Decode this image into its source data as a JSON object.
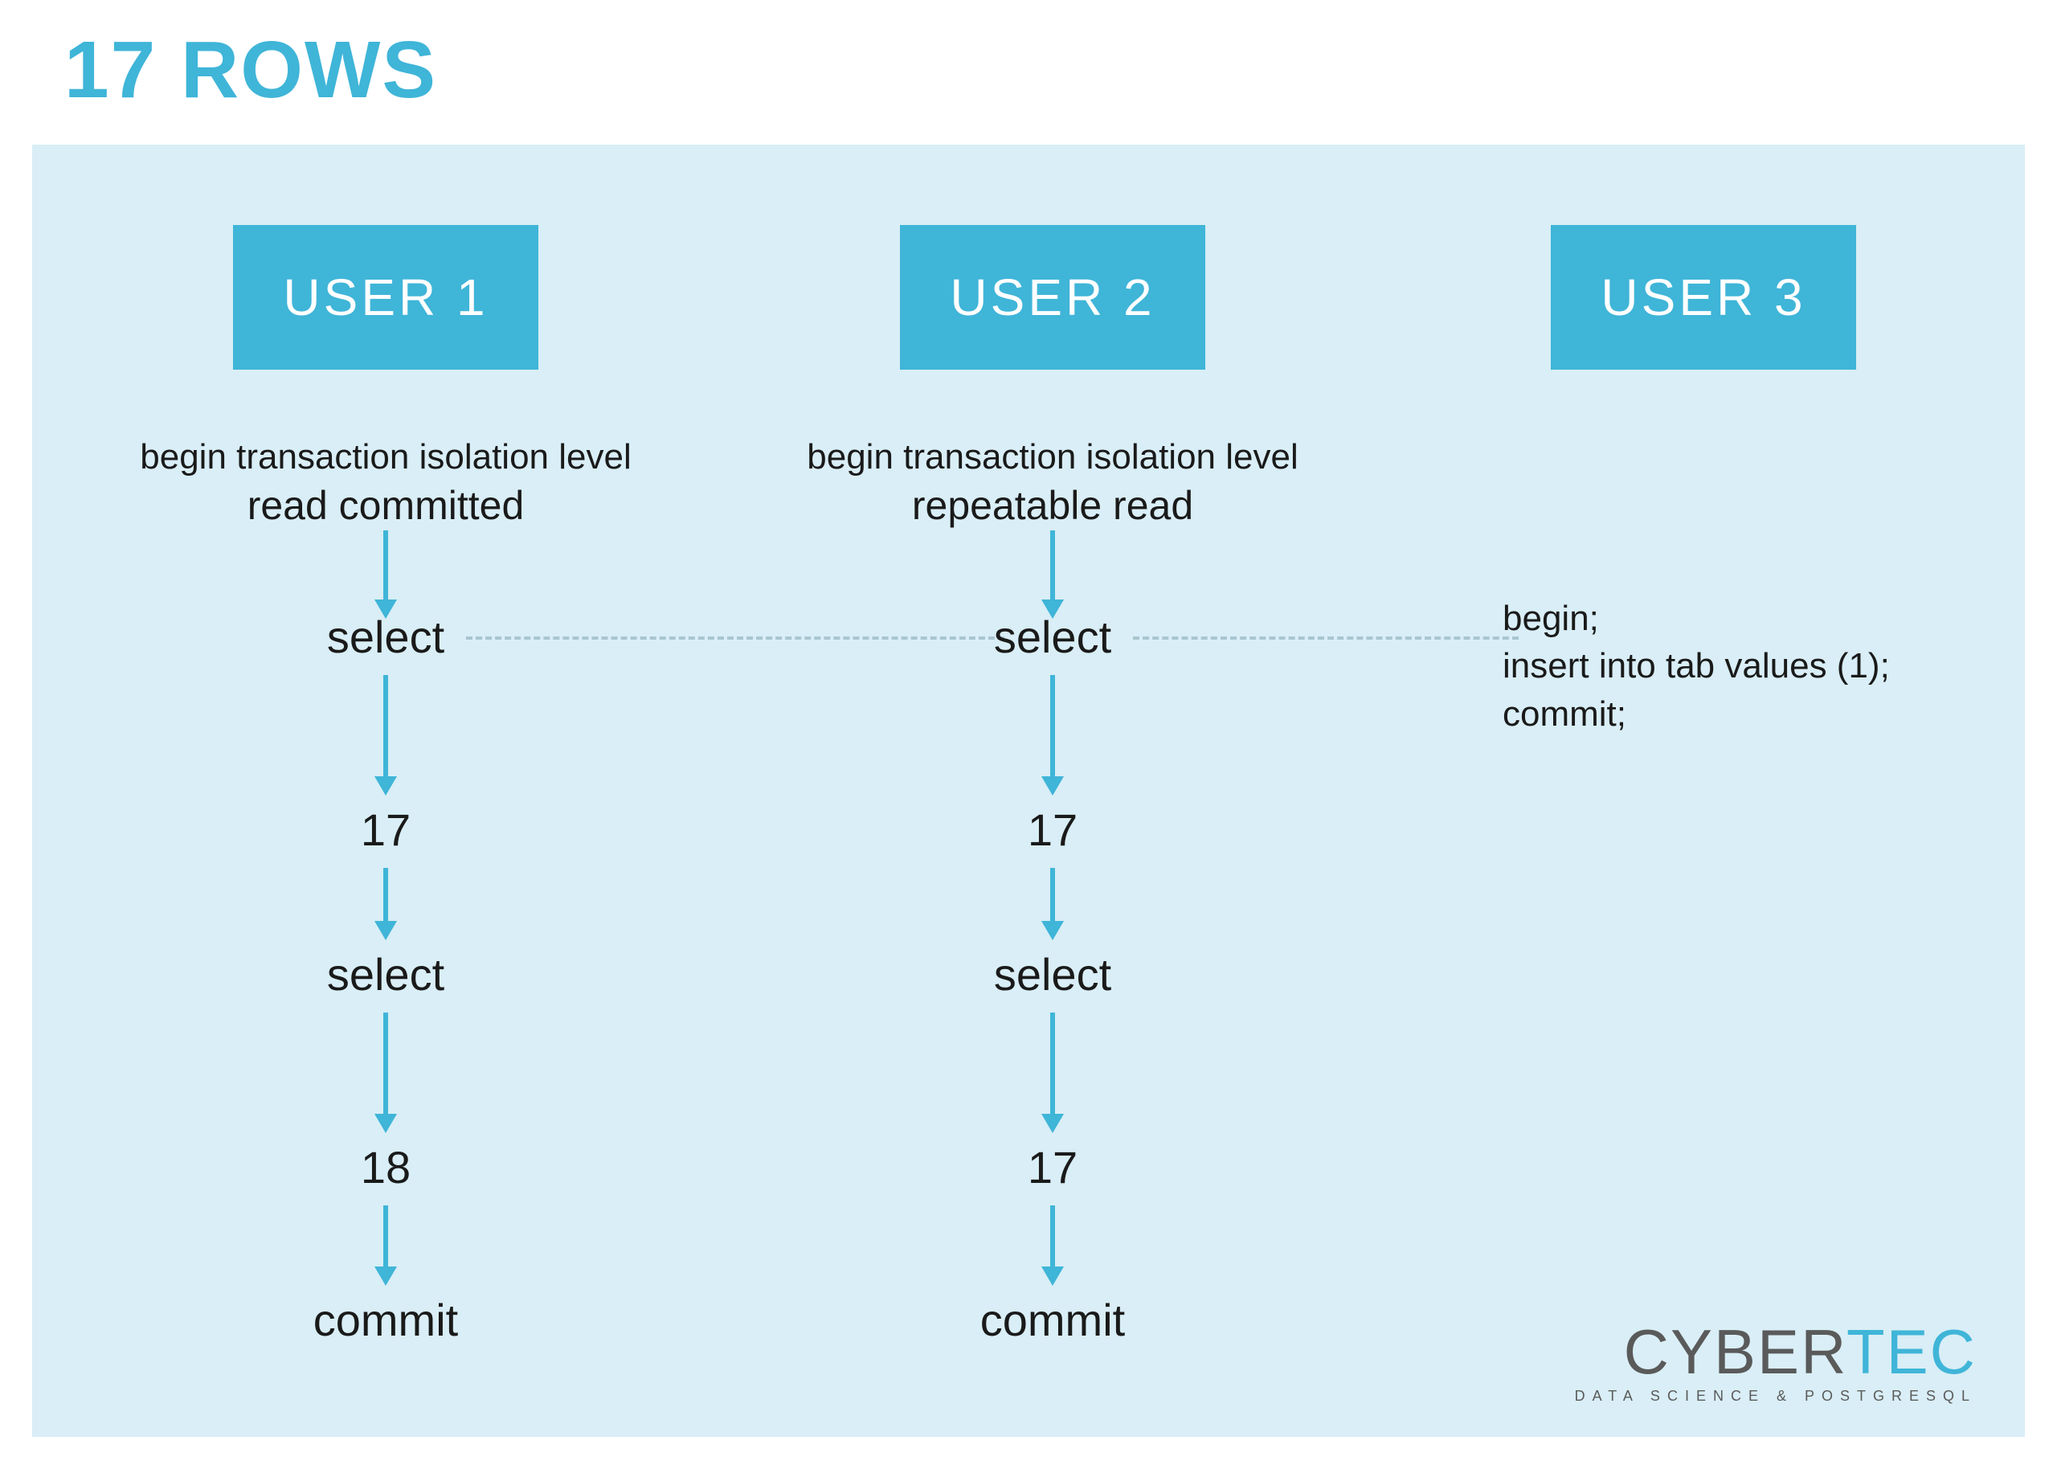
{
  "title": "17 ROWS",
  "colors": {
    "accent": "#3fb5d8",
    "canvas": "#d9eef6",
    "text": "#1a1a1a"
  },
  "users": {
    "u1": {
      "label": "USER 1",
      "begin_prefix": "begin transaction isolation level",
      "isolation": "read committed",
      "timeline": [
        "select",
        "17",
        "select",
        "18",
        "commit"
      ]
    },
    "u2": {
      "label": "USER 2",
      "begin_prefix": "begin transaction isolation level",
      "isolation": "repeatable read",
      "timeline": [
        "select",
        "17",
        "select",
        "17",
        "commit"
      ]
    },
    "u3": {
      "label": "USER 3",
      "statements": [
        "begin;",
        "insert into tab values (1);",
        "commit;"
      ]
    }
  },
  "logo": {
    "part1": "CYBER",
    "part2": "TEC",
    "tagline": "DATA SCIENCE & POSTGRESQL"
  }
}
